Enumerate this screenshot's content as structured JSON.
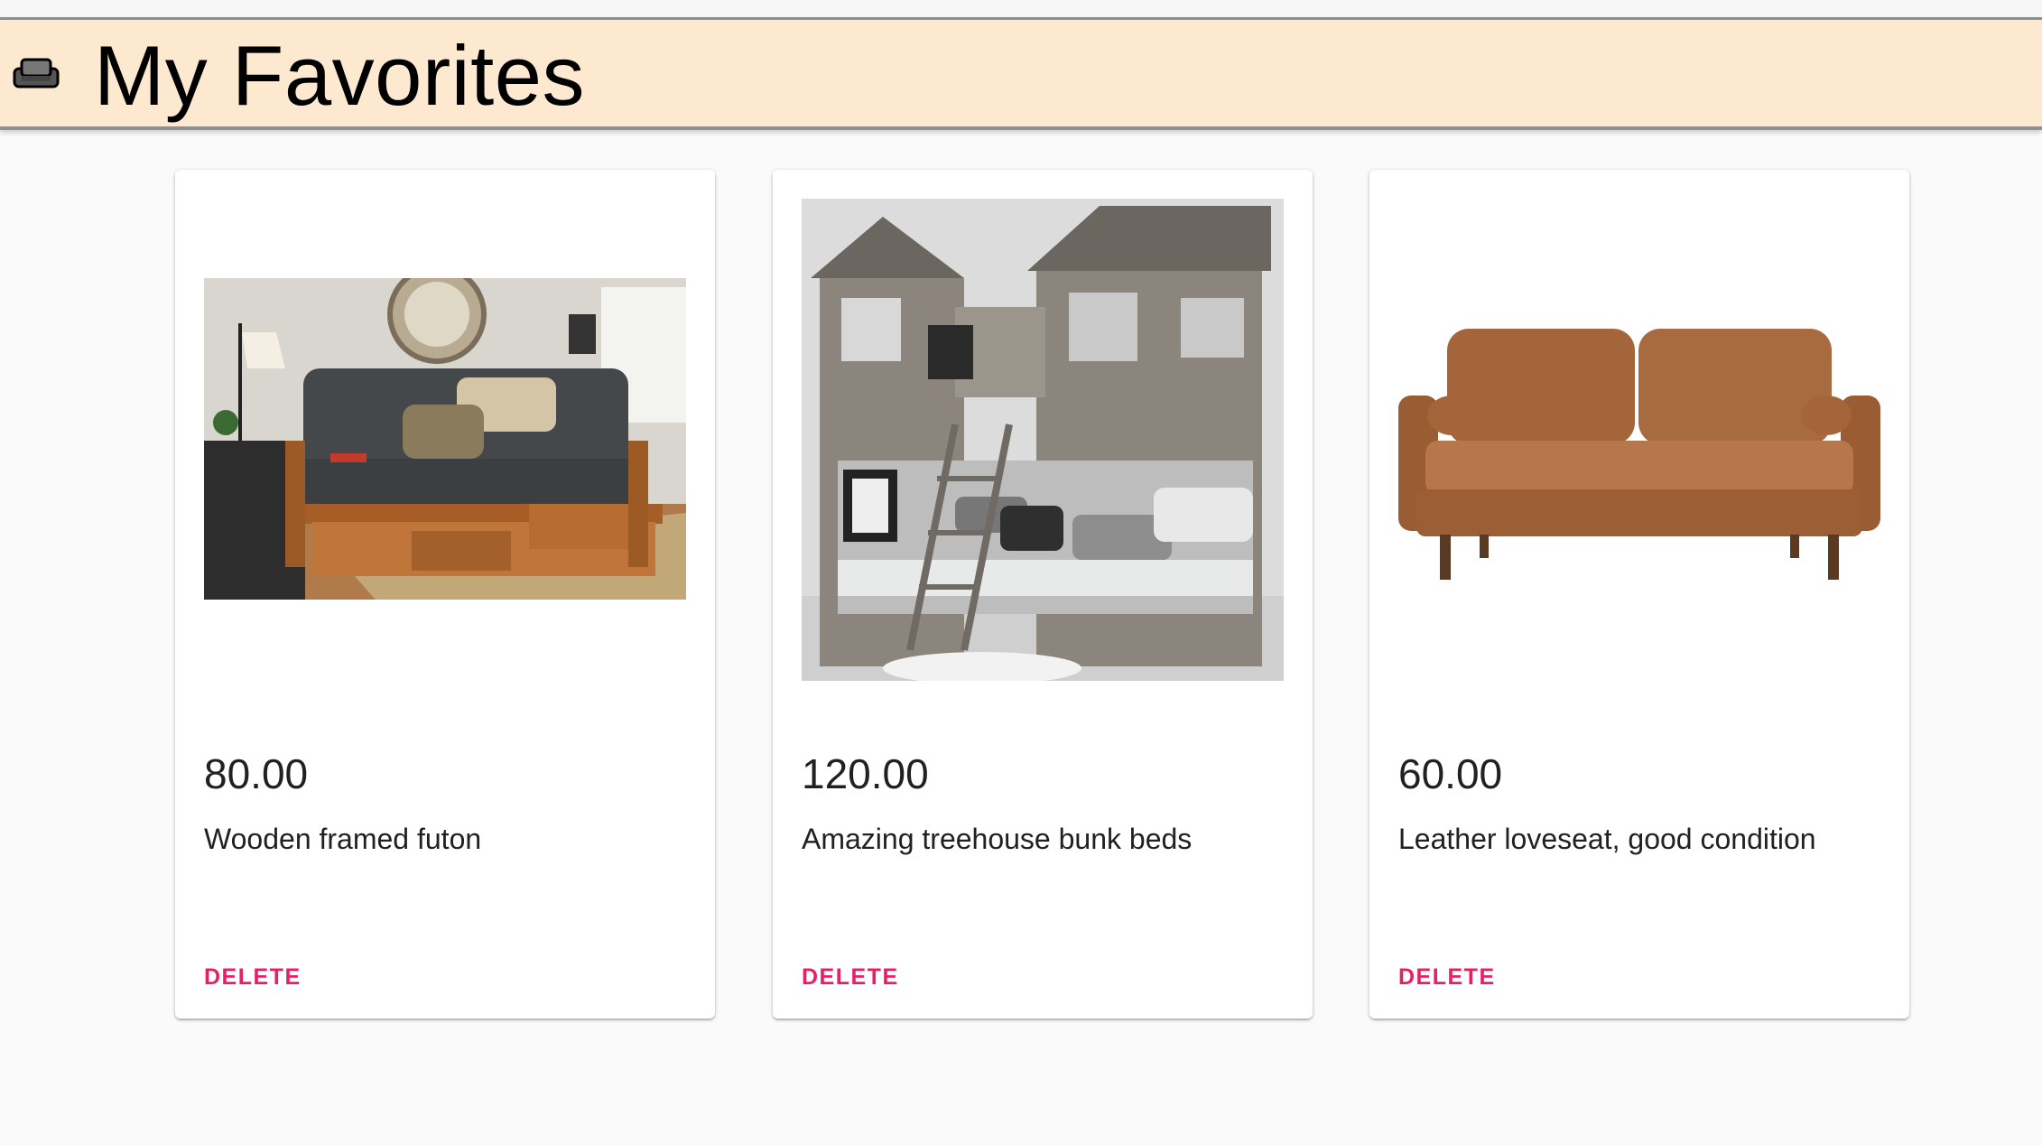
{
  "header": {
    "title": "My Favorites",
    "icon": "couch-icon",
    "background": "#fde9cf"
  },
  "favorites": [
    {
      "price": "80.00",
      "description": "Wooden framed futon",
      "delete_label": "DELETE",
      "image": "futon-photo"
    },
    {
      "price": "120.00",
      "description": "Amazing treehouse bunk beds",
      "delete_label": "DELETE",
      "image": "bunk-beds-photo"
    },
    {
      "price": "60.00",
      "description": "Leather loveseat, good condition",
      "delete_label": "DELETE",
      "image": "loveseat-photo"
    }
  ],
  "colors": {
    "accent": "#e91e63",
    "text": "#212121",
    "page_bg": "#fafafa"
  }
}
